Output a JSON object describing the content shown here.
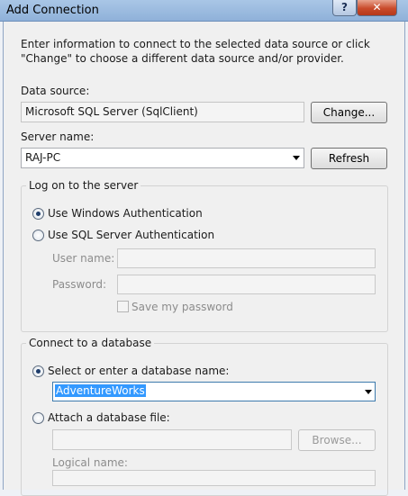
{
  "window": {
    "title": "Add Connection"
  },
  "intro": "Enter information to connect to the selected data source or click \"Change\" to choose a different data source and/or provider.",
  "data_source": {
    "label": "Data source:",
    "value": "Microsoft SQL Server (SqlClient)",
    "change_button": "Change..."
  },
  "server": {
    "label": "Server name:",
    "value": "RAJ-PC",
    "refresh_button": "Refresh"
  },
  "logon": {
    "group_label": "Log on to the server",
    "windows_auth": "Use Windows Authentication",
    "sql_auth": "Use SQL Server Authentication",
    "user_name_label": "User name:",
    "password_label": "Password:",
    "save_password_label": "Save my password"
  },
  "database": {
    "group_label": "Connect to a database",
    "select_option": "Select or enter a database name:",
    "database_value": "AdventureWorks",
    "attach_option": "Attach a database file:",
    "browse_button": "Browse...",
    "logical_name_label": "Logical name:"
  }
}
